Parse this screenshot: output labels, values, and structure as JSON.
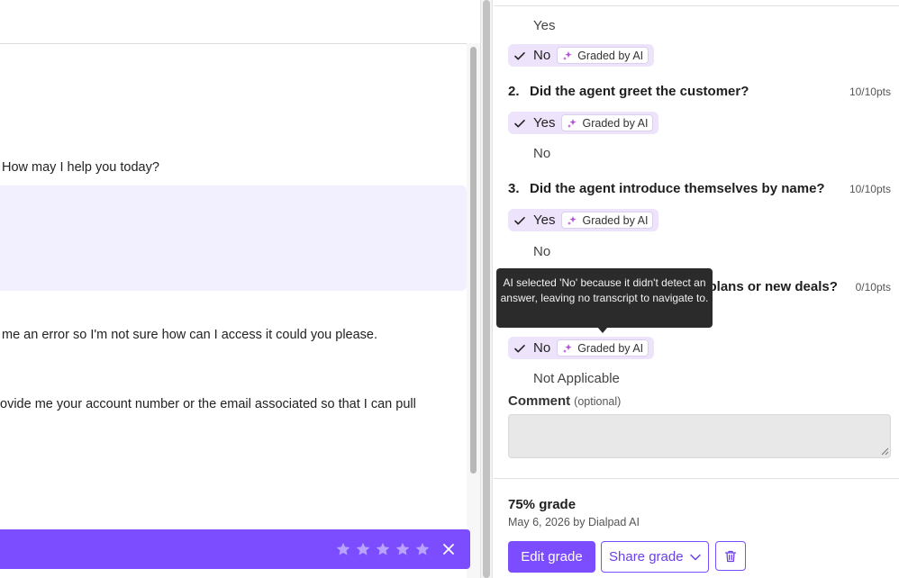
{
  "transcript": {
    "lines": [
      " How may I help you today?",
      " me an error so I'm not sure how can I access it could you please.",
      "ovide me your account number or the email associated so that I can pull"
    ]
  },
  "rating_bar": {
    "stars_total": 5,
    "close_icon": "close-icon"
  },
  "grading": {
    "q1": {
      "options": [
        "Yes",
        "No"
      ],
      "selected": "No",
      "badge": "Graded by AI"
    },
    "q2": {
      "number": "2.",
      "question": "Did the agent greet the customer?",
      "points": "10/10pts",
      "selected": "Yes",
      "badge": "Graded by AI",
      "other_option": "No"
    },
    "q3": {
      "number": "3.",
      "question": "Did the agent introduce themselves by name?",
      "points": "10/10pts",
      "selected": "Yes",
      "badge": "Graded by AI",
      "other_option": "No"
    },
    "q4": {
      "question_visible": "y plans or new deals?",
      "points": "0/10pts",
      "selected": "No",
      "badge": "Graded by AI",
      "other_option": "Not Applicable"
    },
    "tooltip": "AI selected 'No' because it didn't detect an answer, leaving no transcript to navigate to.",
    "comment": {
      "label": "Comment",
      "optional": "(optional)",
      "value": ""
    }
  },
  "footer": {
    "grade": "75% grade",
    "meta": "May 6, 2026 by Dialpad AI",
    "edit_button": "Edit grade",
    "share_button": "Share grade"
  },
  "colors": {
    "accent": "#7c4dff",
    "chip_bg": "#ede4fb",
    "highlight": "#f2effe",
    "tooltip_bg": "#2b2b2b"
  }
}
